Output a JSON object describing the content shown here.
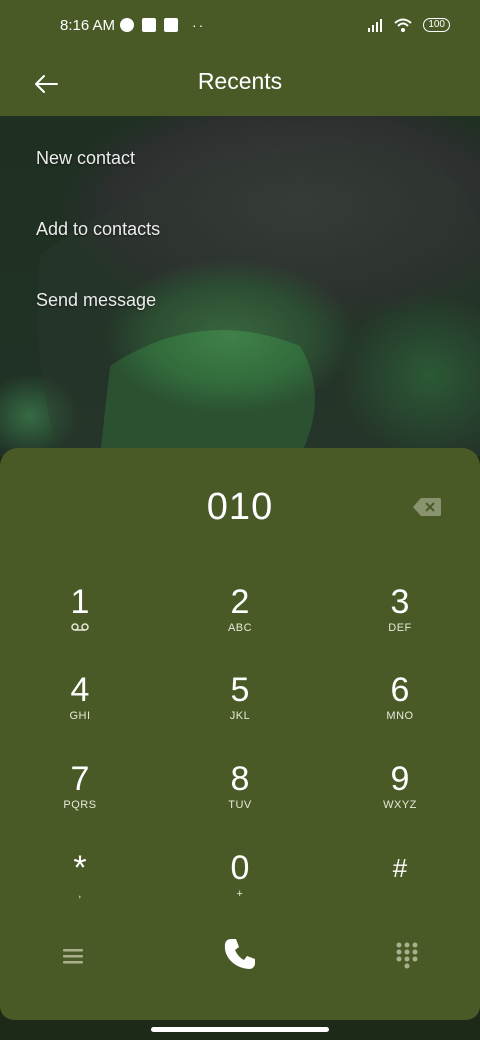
{
  "status": {
    "time": "8:16 AM",
    "dots": "··",
    "battery": "100"
  },
  "header": {
    "title": "Recents"
  },
  "menu": [
    {
      "label": "New contact"
    },
    {
      "label": "Add to contacts"
    },
    {
      "label": "Send message"
    }
  ],
  "dialer": {
    "number": "010",
    "keys": [
      {
        "digit": "1",
        "letters": ""
      },
      {
        "digit": "2",
        "letters": "ABC"
      },
      {
        "digit": "3",
        "letters": "DEF"
      },
      {
        "digit": "4",
        "letters": "GHI"
      },
      {
        "digit": "5",
        "letters": "JKL"
      },
      {
        "digit": "6",
        "letters": "MNO"
      },
      {
        "digit": "7",
        "letters": "PQRS"
      },
      {
        "digit": "8",
        "letters": "TUV"
      },
      {
        "digit": "9",
        "letters": "WXYZ"
      },
      {
        "digit": "*",
        "letters": ","
      },
      {
        "digit": "0",
        "letters": "+"
      },
      {
        "digit": "#",
        "letters": ""
      }
    ]
  },
  "colors": {
    "bar": "#4a5a27",
    "dialer": "#4a5a27"
  },
  "icons": {
    "back": "arrow-left-icon",
    "delete": "backspace-icon",
    "voicemail": "voicemail-icon",
    "menu": "hamburger-icon",
    "call": "phone-icon",
    "keypad": "dialpad-icon"
  }
}
